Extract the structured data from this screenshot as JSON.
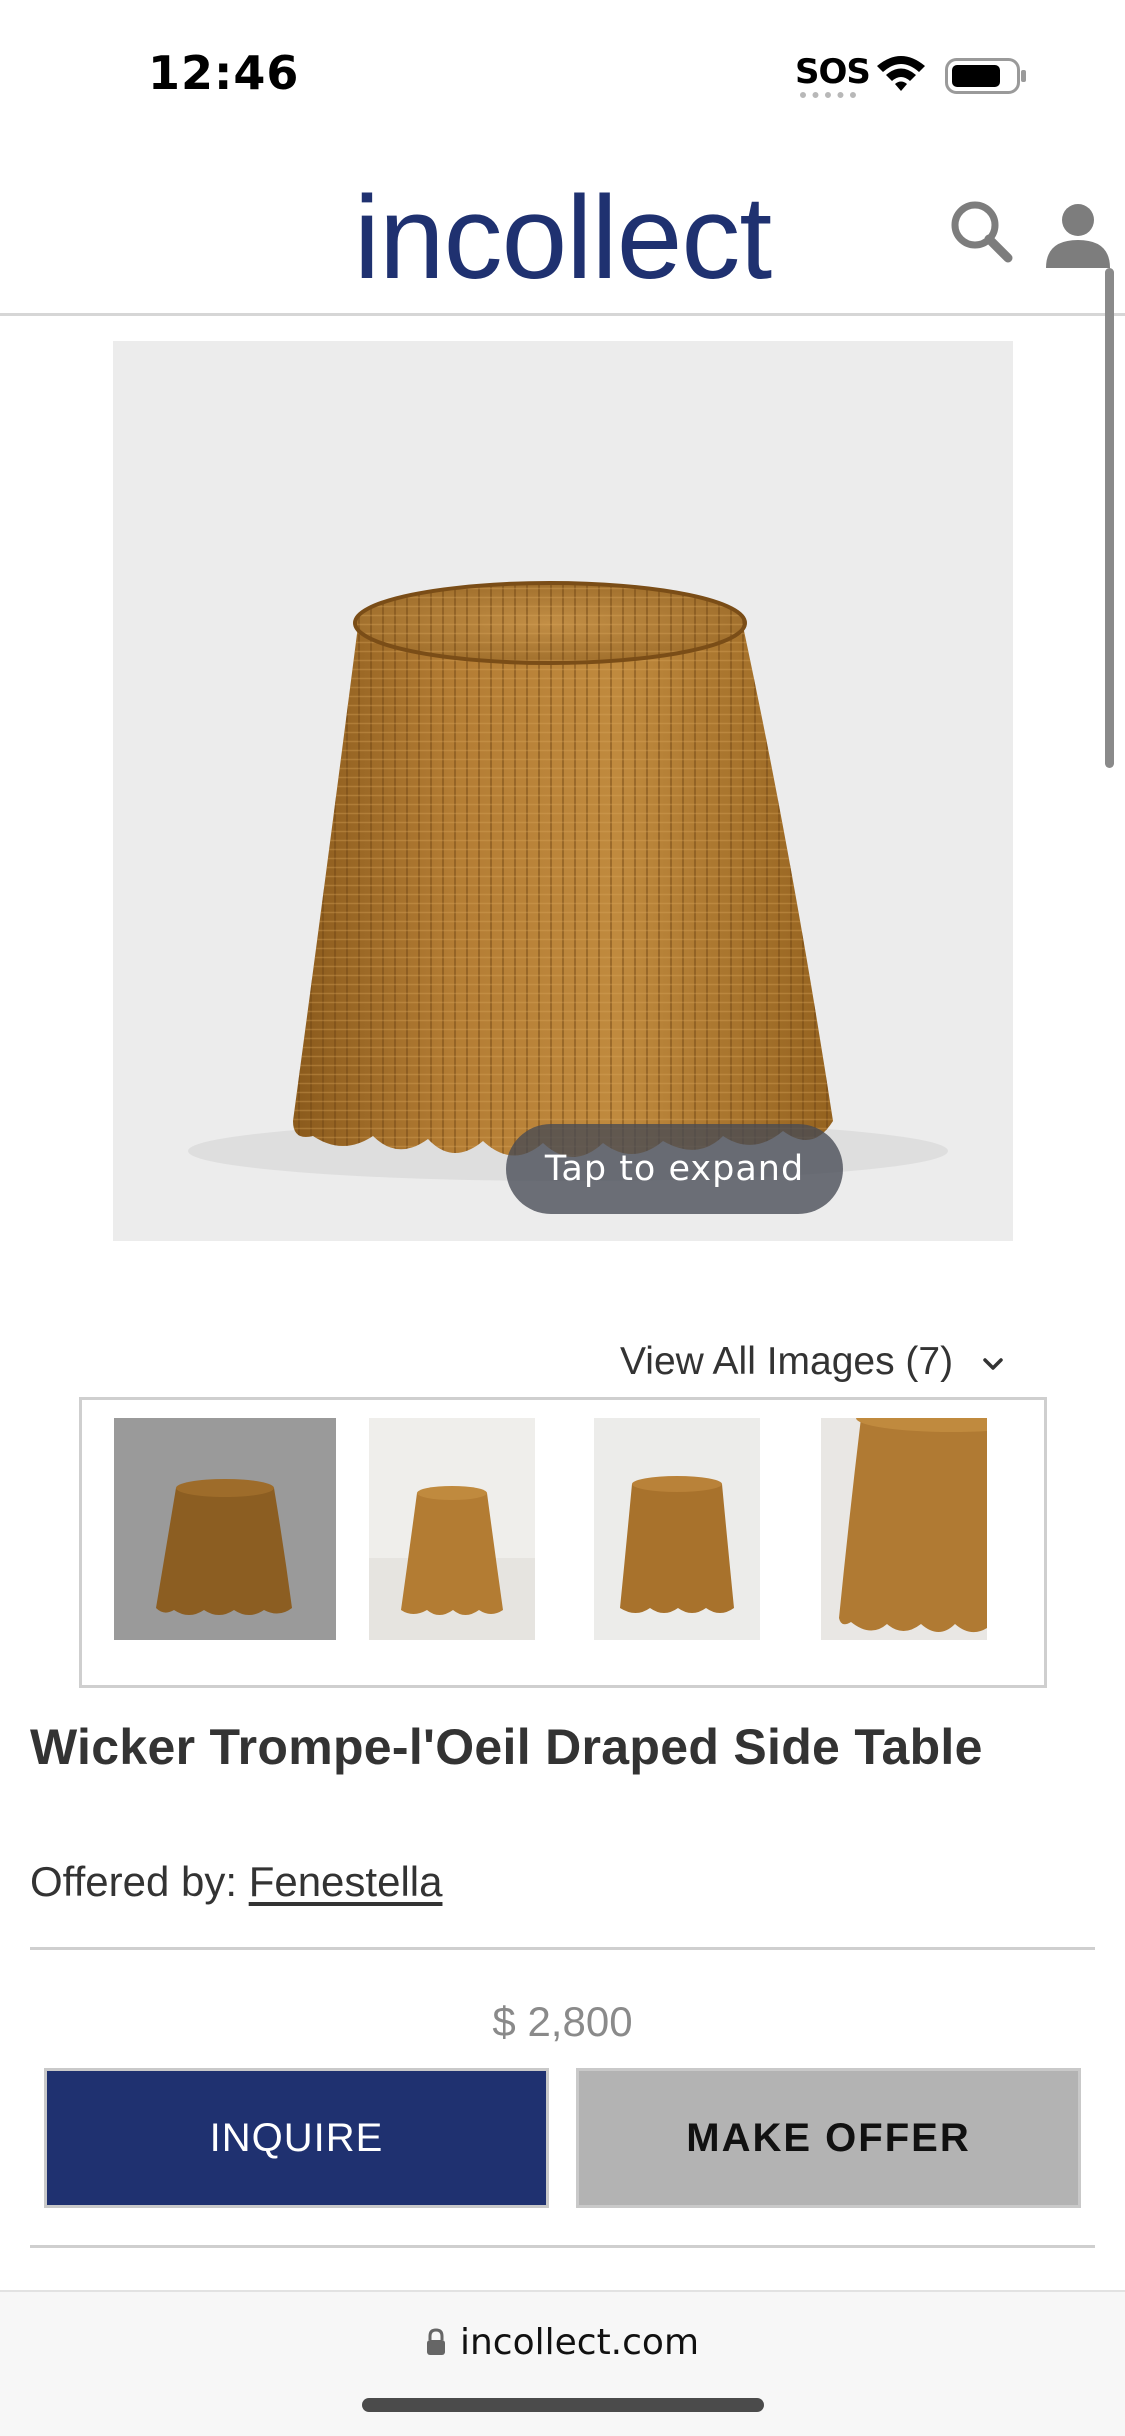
{
  "status_bar": {
    "time": "12:46",
    "sos": "SOS",
    "icons": [
      "wifi-icon",
      "battery-icon"
    ]
  },
  "header": {
    "logo": "incollect",
    "brand_color": "#1f3170",
    "icons": [
      "search-icon",
      "account-icon"
    ]
  },
  "hero": {
    "expand_label": "Tap to expand",
    "background": "#ececec"
  },
  "gallery": {
    "view_all_label": "View All Images (7)",
    "thumbnail_count_visible": 4,
    "selected_index": 0
  },
  "product": {
    "title": "Wicker Trompe-l'Oeil Draped Side Table",
    "offered_by_label": "Offered by:",
    "dealer": "Fenestella",
    "price": "$ 2,800"
  },
  "actions": {
    "inquire_label": "INQUIRE",
    "offer_label": "MAKE OFFER",
    "inquire_color": "#1f3170",
    "offer_color": "#b3b3b3"
  },
  "browser": {
    "url": "incollect.com"
  }
}
